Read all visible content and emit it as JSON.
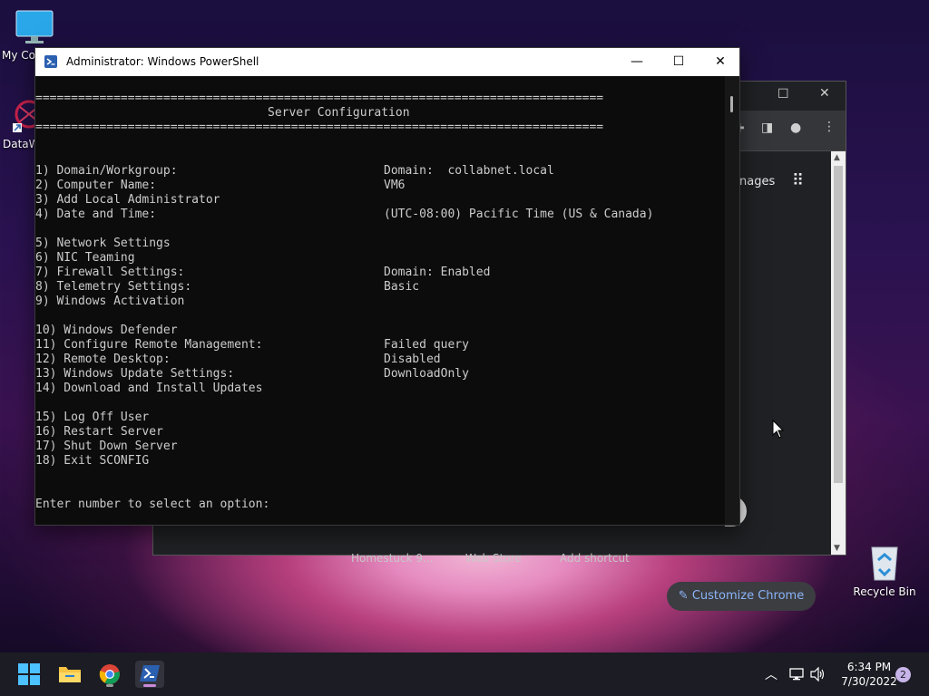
{
  "desktop": {
    "icons": [
      {
        "label": "My Co"
      },
      {
        "label": "DataW"
      },
      {
        "label": "Recycle Bin"
      }
    ]
  },
  "chrome": {
    "tab_text": "nages",
    "customize_label": "Customize Chrome",
    "shortcuts": [
      "Homestuck 9...",
      "Web Store",
      "Add shortcut"
    ]
  },
  "powershell": {
    "title": "Administrator: Windows PowerShell",
    "separator": "================================================================================",
    "heading": "Server Configuration",
    "options": [
      {
        "text": "1) Domain/Workgroup:",
        "value": "Domain:  collabnet.local"
      },
      {
        "text": "2) Computer Name:",
        "value": "VM6"
      },
      {
        "text": "3) Add Local Administrator",
        "value": ""
      },
      {
        "text": "4) Date and Time:",
        "value": "(UTC-08:00) Pacific Time (US & Canada)"
      },
      {
        "text": "5) Network Settings",
        "value": ""
      },
      {
        "text": "6) NIC Teaming",
        "value": ""
      },
      {
        "text": "7) Firewall Settings:",
        "value": "Domain: Enabled"
      },
      {
        "text": "8) Telemetry Settings:",
        "value": "Basic"
      },
      {
        "text": "9) Windows Activation",
        "value": ""
      },
      {
        "text": "10) Windows Defender",
        "value": ""
      },
      {
        "text": "11) Configure Remote Management:",
        "value": "Failed query"
      },
      {
        "text": "12) Remote Desktop:",
        "value": "Disabled"
      },
      {
        "text": "13) Windows Update Settings:",
        "value": "DownloadOnly"
      },
      {
        "text": "14) Download and Install Updates",
        "value": ""
      },
      {
        "text": "15) Log Off User",
        "value": ""
      },
      {
        "text": "16) Restart Server",
        "value": ""
      },
      {
        "text": "17) Shut Down Server",
        "value": ""
      },
      {
        "text": "18) Exit SCONFIG",
        "value": ""
      }
    ],
    "prompt": "Enter number to select an option:"
  },
  "taskbar": {
    "time": "6:34 PM",
    "date": "7/30/2022",
    "notification_count": "2"
  },
  "icons": {
    "start": "windows-logo-icon",
    "explorer": "folder-icon",
    "chrome": "chrome-icon",
    "powershell": "powershell-icon",
    "tray_up": "chevron-up-icon",
    "network": "network-icon",
    "volume": "volume-icon"
  },
  "colors": {
    "terminal_bg": "#0c0c0c",
    "terminal_text": "#cccccc",
    "taskbar_bg": "#1c1c24",
    "chrome_link": "#8ab4f8"
  }
}
